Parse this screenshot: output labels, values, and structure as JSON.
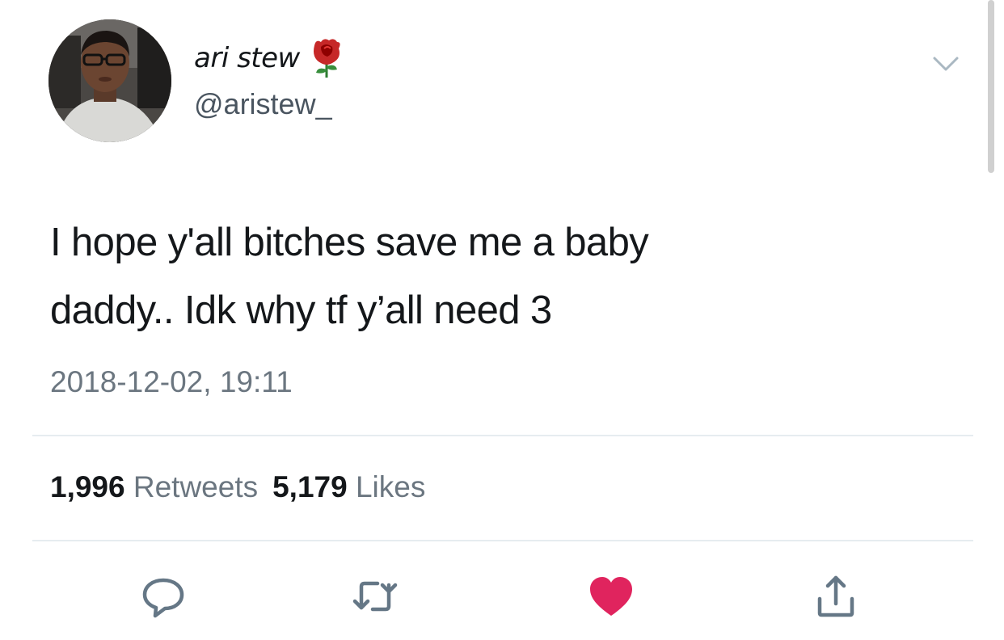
{
  "tweet": {
    "author": {
      "display_name": "ari stew",
      "handle": "@aristew_",
      "name_emoji_icon": "rose-icon",
      "avatar_icon": "profile-photo"
    },
    "text_line_1": "I hope y'all bitches save me a baby",
    "text_line_2": "daddy.. Idk why tf y’all need 3",
    "timestamp": "2018-12-02, 19:11",
    "stats": {
      "retweets_count": "1,996",
      "retweets_label": "Retweets",
      "likes_count": "5,179",
      "likes_label": "Likes"
    },
    "actions": [
      {
        "icon": "reply-icon"
      },
      {
        "icon": "retweet-icon"
      },
      {
        "icon": "heart-icon",
        "active": true
      },
      {
        "icon": "share-icon"
      }
    ],
    "menu_icon": "chevron-down-icon"
  },
  "colors": {
    "text_primary": "#14171a",
    "text_secondary": "#6b7680",
    "like_active": "#e0245e",
    "divider": "#e6ecf0",
    "icon_gray": "#657786"
  }
}
